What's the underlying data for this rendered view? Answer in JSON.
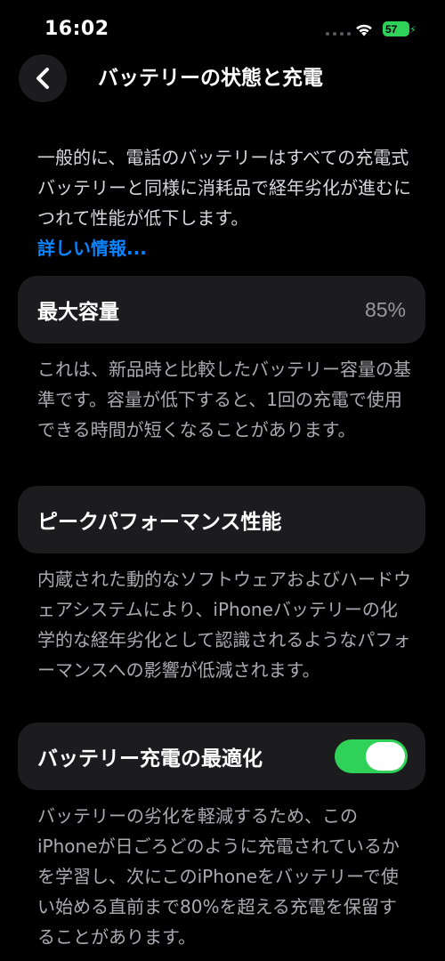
{
  "status_bar": {
    "time": "16:02",
    "battery_level": "57",
    "icons": [
      "signal-dots-icon",
      "wifi-icon",
      "battery-icon",
      "charging-bolt-icon"
    ],
    "battery_color": "#30d158"
  },
  "nav": {
    "back_icon": "chevron-left-icon",
    "title": "バッテリーの状態と充電"
  },
  "intro": {
    "text": "一般的に、電話のバッテリーはすべての充電式バッテリーと同様に消耗品で経年劣化が進むにつれて性能が低下します。",
    "link": "詳しい情報..."
  },
  "max_capacity": {
    "label": "最大容量",
    "value": "85%",
    "description": "これは、新品時と比較したバッテリー容量の基準です。容量が低下すると、1回の充電で使用できる時間が短くなることがあります。"
  },
  "peak_performance": {
    "label": "ピークパフォーマンス性能",
    "description": "内蔵された動的なソフトウェアおよびハードウェアシステムにより、iPhoneバッテリーの化学的な経年劣化として認識されるようなパフォーマンスへの影響が低減されます。"
  },
  "optimized_charging": {
    "label": "バッテリー充電の最適化",
    "enabled": true,
    "toggle_color": "#30d158",
    "description": "バッテリーの劣化を軽減するため、このiPhoneが日ごろどのように充電されているかを学習し、次にこのiPhoneをバッテリーで使い始める直前まで80%を超える充電を保留することがあります。"
  }
}
